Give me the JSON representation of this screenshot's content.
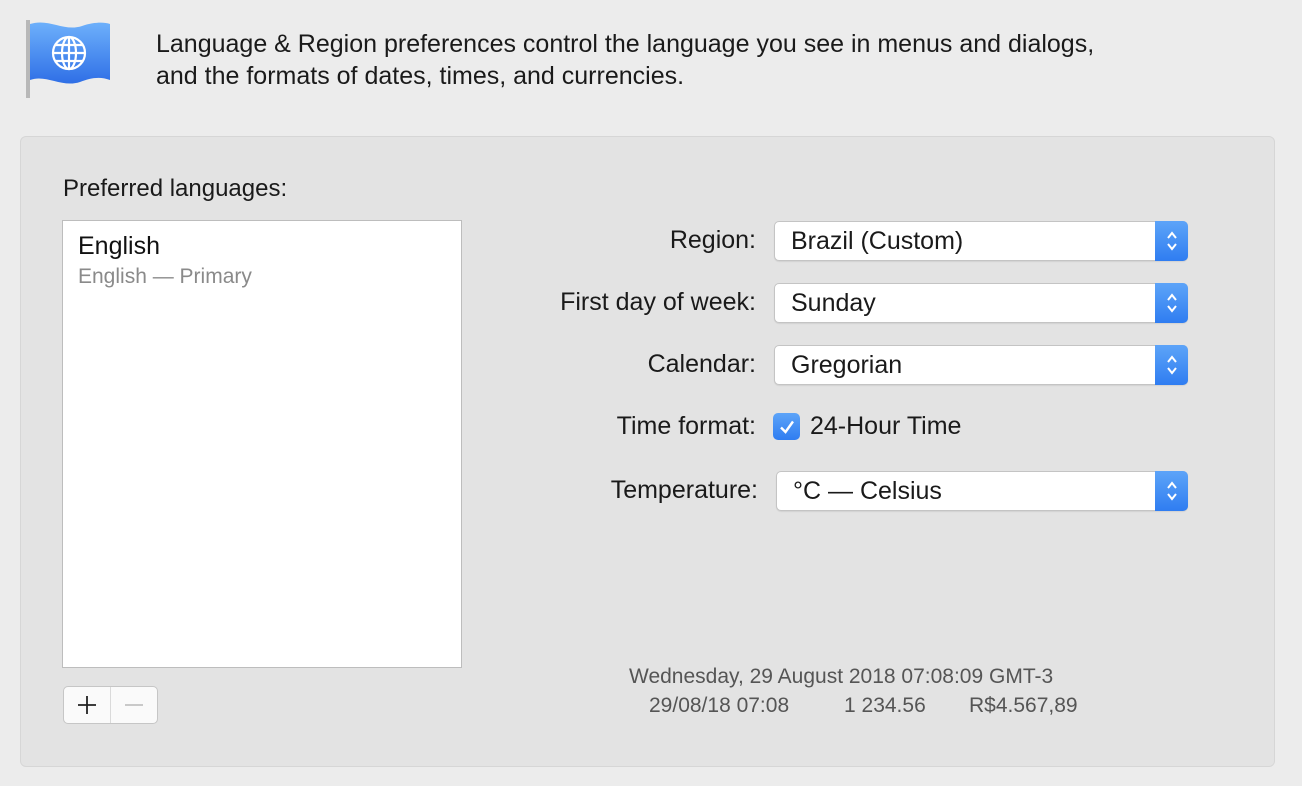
{
  "header": {
    "icon": "globe-flag-icon",
    "description_line1": "Language & Region preferences control the language you see in menus and dialogs,",
    "description_line2": "and the formats of dates, times, and currencies."
  },
  "languages": {
    "title": "Preferred languages:",
    "items": [
      {
        "name": "English",
        "detail": "English — Primary"
      }
    ],
    "add_icon": "plus-icon",
    "remove_icon": "minus-icon"
  },
  "settings": {
    "region": {
      "label": "Region:",
      "value": "Brazil (Custom)"
    },
    "first_day": {
      "label": "First day of week:",
      "value": "Sunday"
    },
    "calendar": {
      "label": "Calendar:",
      "value": "Gregorian"
    },
    "time_format": {
      "label": "Time format:",
      "checkbox_label": "24-Hour Time",
      "checked": true
    },
    "temperature": {
      "label": "Temperature:",
      "value": "°C — Celsius"
    }
  },
  "sample": {
    "long_date": "Wednesday, 29 August 2018 07:08:09 GMT-3",
    "short_date": "29/08/18 07:08",
    "number": "1 234.56",
    "currency": "R$4.567,89"
  },
  "colors": {
    "accent": "#2f7df1",
    "background": "#ececec",
    "panel": "#e3e3e3"
  }
}
